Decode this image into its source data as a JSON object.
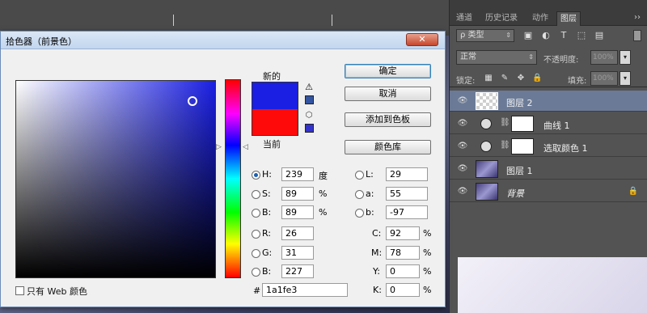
{
  "panel": {
    "tabs": [
      "通道",
      "历史记录",
      "动作",
      "图层"
    ],
    "menu_icon": "››",
    "kind_select": "ρ 类型",
    "blend_mode": "正常",
    "opacity_label": "不透明度:",
    "opacity_value": "100%",
    "lock_label": "锁定:",
    "fill_label": "填充:",
    "fill_value": "100%",
    "layers": [
      {
        "name": "图层 2",
        "selected": true
      },
      {
        "name": "曲线 1"
      },
      {
        "name": "选取颜色 1"
      },
      {
        "name": "图层 1"
      },
      {
        "name": "背景",
        "locked": true
      }
    ]
  },
  "dialog": {
    "title": "拾色器（前景色）",
    "close_label": "✕",
    "label_new": "新的",
    "label_current": "当前",
    "new_color": "#1a1fe3",
    "current_color": "#ff0a0a",
    "buttons": {
      "ok": "确定",
      "cancel": "取消",
      "add_swatches": "添加到色板",
      "color_libraries": "颜色库"
    },
    "fields": {
      "H": {
        "label": "H:",
        "value": "239",
        "unit": "度"
      },
      "S": {
        "label": "S:",
        "value": "89",
        "unit": "%"
      },
      "Bv": {
        "label": "B:",
        "value": "89",
        "unit": "%"
      },
      "R": {
        "label": "R:",
        "value": "26"
      },
      "G": {
        "label": "G:",
        "value": "31"
      },
      "B": {
        "label": "B:",
        "value": "227"
      },
      "L": {
        "label": "L:",
        "value": "29"
      },
      "a": {
        "label": "a:",
        "value": "55"
      },
      "b": {
        "label": "b:",
        "value": "-97"
      },
      "C": {
        "label": "C:",
        "value": "92",
        "unit": "%"
      },
      "M": {
        "label": "M:",
        "value": "78",
        "unit": "%"
      },
      "Y": {
        "label": "Y:",
        "value": "0",
        "unit": "%"
      },
      "K": {
        "label": "K:",
        "value": "0",
        "unit": "%"
      }
    },
    "hex_label": "#",
    "hex_value": "1a1fe3",
    "web_only_label": "只有 Web 颜色"
  }
}
